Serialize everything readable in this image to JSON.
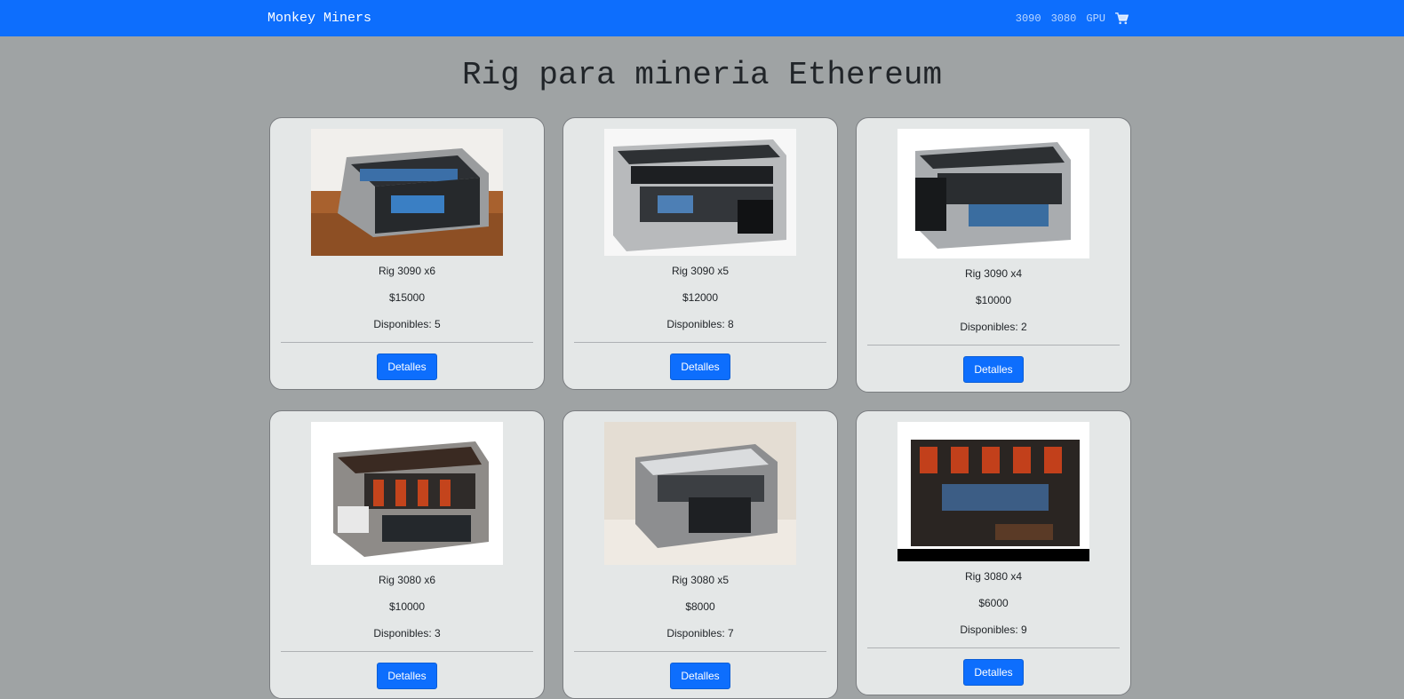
{
  "navbar": {
    "brand": "Monkey Miners",
    "links": [
      "3090",
      "3080",
      "GPU"
    ],
    "cart_icon": "shopping-cart-icon"
  },
  "page": {
    "title": "Rig para mineria Ethereum"
  },
  "products": [
    {
      "name": "Rig 3090 x6",
      "price": "$15000",
      "stock": "Disponibles: 5",
      "button": "Detalles"
    },
    {
      "name": "Rig 3090 x5",
      "price": "$12000",
      "stock": "Disponibles: 8",
      "button": "Detalles"
    },
    {
      "name": "Rig 3090 x4",
      "price": "$10000",
      "stock": "Disponibles: 2",
      "button": "Detalles"
    },
    {
      "name": "Rig 3080 x6",
      "price": "$10000",
      "stock": "Disponibles: 3",
      "button": "Detalles"
    },
    {
      "name": "Rig 3080 x5",
      "price": "$8000",
      "stock": "Disponibles: 7",
      "button": "Detalles"
    },
    {
      "name": "Rig 3080 x4",
      "price": "$6000",
      "stock": "Disponibles: 9",
      "button": "Detalles"
    }
  ],
  "colors": {
    "primary": "#0d6efd",
    "background": "#9fa3a4",
    "card": "#e4e7e7"
  }
}
